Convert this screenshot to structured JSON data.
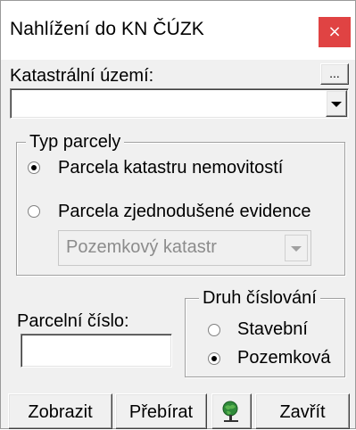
{
  "window": {
    "title": "Nahlížení do KN ČÚZK",
    "close_label": "×"
  },
  "cadastral": {
    "label": "Katastrální území:",
    "browse_label": "...",
    "value": ""
  },
  "parcel_type": {
    "legend": "Typ parcely",
    "options": [
      {
        "label": "Parcela katastru nemovitostí",
        "selected": true
      },
      {
        "label": "Parcela zjednodušené evidence",
        "selected": false
      }
    ],
    "evidence_select_value": "Pozemkový katastr"
  },
  "parcel_number": {
    "label": "Parcelní číslo:",
    "value": ""
  },
  "numbering": {
    "legend": "Druh číslování",
    "options": [
      {
        "label": "Stavební",
        "selected": false
      },
      {
        "label": "Pozemková",
        "selected": true
      }
    ]
  },
  "buttons": {
    "show": "Zobrazit",
    "take": "Přebírat",
    "map_icon": "globe-pin-icon",
    "close": "Zavřít"
  }
}
